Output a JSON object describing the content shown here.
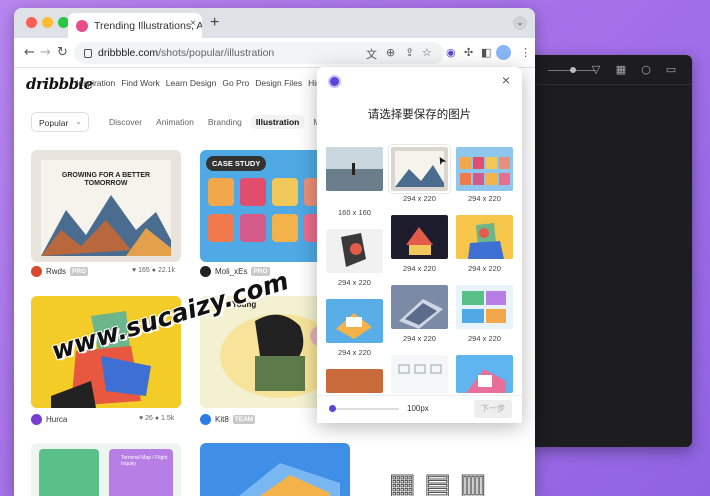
{
  "browser": {
    "tab_title": "Trending Illustrations, Artwork",
    "tab_close": "×",
    "new_tab": "+",
    "url_domain": "dribbble.com",
    "url_path": "/shots/popular/illustration"
  },
  "site": {
    "logo": "dribbble",
    "nav": [
      "Inspiration",
      "Find Work",
      "Learn Design",
      "Go Pro",
      "Design Files",
      "Hire Desi"
    ],
    "filter_dropdown": "Popular",
    "categories": [
      "Discover",
      "Animation",
      "Branding",
      "Illustration",
      "Mob"
    ],
    "selected_category": "Illustration"
  },
  "shots": [
    {
      "author": "Rwds",
      "badge": "PRO",
      "likes": "165",
      "views": "22.1k",
      "case_study": "",
      "poster_text": "GROWING FOR A BETTER TOMORROW"
    },
    {
      "author": "Moli_xEs",
      "badge": "PRO",
      "likes": "",
      "views": "",
      "case_study": "CASE STUDY",
      "poster_text": ""
    },
    {
      "author": "Hurca",
      "badge": "",
      "likes": "26",
      "views": "1.5k",
      "case_study": "",
      "poster_text": ""
    },
    {
      "author": "Kit8",
      "badge": "TEAM",
      "likes": "",
      "views": "",
      "case_study": "",
      "poster_text": "Young"
    },
    {
      "author": "",
      "badge": "",
      "likes": "",
      "views": "",
      "case_study": "",
      "poster_text": "Terminal Map / Flight Inquiry"
    }
  ],
  "popup": {
    "title": "请选择要保存的图片",
    "close": "×",
    "thumbs": [
      {
        "size": "160 x 160",
        "color": "#9fb3c0"
      },
      {
        "size": "294 x 220",
        "color": "#d9d6cf"
      },
      {
        "size": "294 x 220",
        "color": "#8fc6ec"
      },
      {
        "size": "294 x 220",
        "color": "#f1f1f1"
      },
      {
        "size": "294 x 220",
        "color": "#1d1d2e"
      },
      {
        "size": "294 x 220",
        "color": "#f6c64a"
      },
      {
        "size": "294 x 220",
        "color": "#5aaee8"
      },
      {
        "size": "294 x 220",
        "color": "#7b8aa6"
      },
      {
        "size": "294 x 220",
        "color": "#e9f3fb"
      },
      {
        "size": "",
        "color": "#c86a3a"
      },
      {
        "size": "",
        "color": "#f4f6f8"
      },
      {
        "size": "",
        "color": "#5fb5f0"
      }
    ],
    "slider_value": "100px",
    "next_label": "下一步"
  },
  "watermark": "www.sucaizy.com",
  "colors": {
    "brand": "#ea4c89",
    "accent": "#5a45d6"
  }
}
